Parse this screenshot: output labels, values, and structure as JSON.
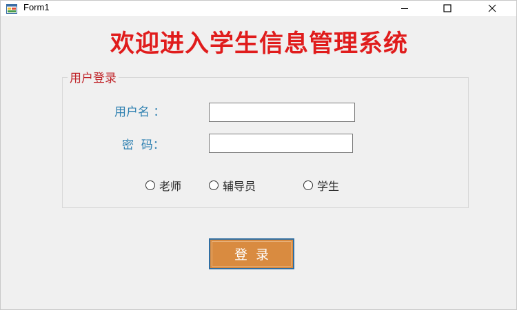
{
  "window": {
    "title": "Form1",
    "icons": {
      "app": "form-icon",
      "minimize": "minimize-icon",
      "maximize": "maximize-icon",
      "close": "close-icon"
    }
  },
  "heading": "欢迎进入学生信息管理系统",
  "login_group": {
    "legend": "用户登录",
    "username_label": "用户名 ：",
    "username_value": "",
    "password_label": "密  码：",
    "password_value": "",
    "roles": [
      {
        "label": "老师",
        "selected": false
      },
      {
        "label": "辅导员",
        "selected": false
      },
      {
        "label": "学生",
        "selected": false
      }
    ]
  },
  "login_button": "登录",
  "colors": {
    "heading": "#e01c1c",
    "legend": "#c0252a",
    "labels": "#2c7fb0",
    "button_bg": "#d98b40",
    "button_border": "#2f6ea3"
  }
}
